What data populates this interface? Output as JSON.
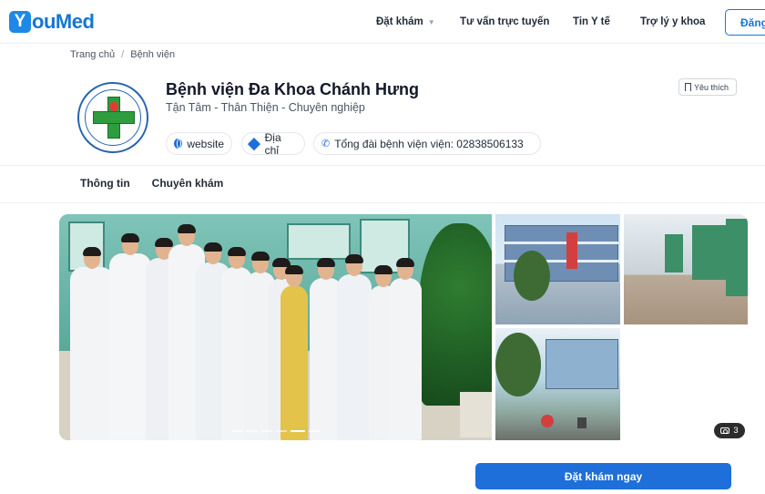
{
  "brand": {
    "logo_letter": "Y",
    "logo_rest": "ouMed"
  },
  "nav": {
    "items": [
      {
        "label": "Đặt khám",
        "has_dropdown": true
      },
      {
        "label": "Tư vấn trực tuyến"
      },
      {
        "label": "Tin Y tế"
      },
      {
        "label": "Trợ lý y khoa"
      }
    ],
    "login_label": "Đăng"
  },
  "breadcrumb": {
    "home": "Trang chủ",
    "separator": "/",
    "current": "Bệnh viện"
  },
  "hospital": {
    "name": "Bệnh viện Đa Khoa Chánh Hưng",
    "slogan": "Tận Tâm - Thân Thiện - Chuyên nghiệp",
    "favorite_label": "Yêu thích",
    "chips": {
      "website": "website",
      "address": "Địa chỉ",
      "hotline": "Tổng đài bệnh viện viện: 02838506133"
    }
  },
  "tabs": [
    "Thông tin",
    "Chuyên khám"
  ],
  "gallery": {
    "more_photos": "3",
    "slide_count": 6,
    "active_slide": 4
  },
  "cta": {
    "book_label": "Đặt khám ngay"
  },
  "colors": {
    "primary": "#1e6fd9",
    "logo_blue": "#1677d2",
    "text": "#1f2937"
  },
  "icons": [
    "globe-icon",
    "location-diamond-icon",
    "phone-icon",
    "bookmark-icon",
    "camera-icon",
    "chevron-down-icon"
  ]
}
